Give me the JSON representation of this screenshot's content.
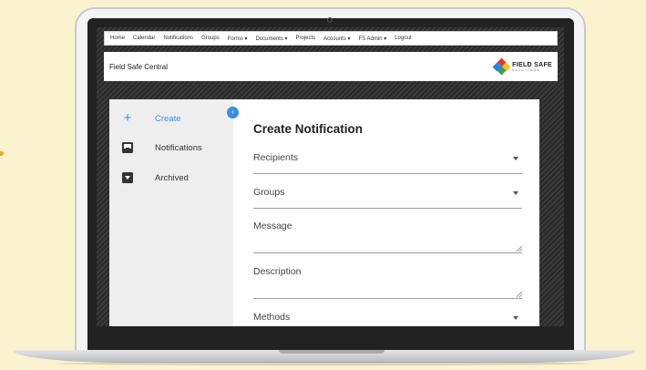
{
  "nav": {
    "items": [
      "Home",
      "Calendar",
      "Notifications",
      "Groups",
      "Forms ▾",
      "Documents ▾",
      "Projects",
      "Accounts ▾",
      "FS Admin ▾",
      "Logout"
    ]
  },
  "header": {
    "title": "Field Safe Central",
    "brand_name": "FIELD SAFE",
    "brand_sub": "SOLUTIONS"
  },
  "sidebar": {
    "items": [
      {
        "label": "Create",
        "icon": "plus-icon",
        "active": true
      },
      {
        "label": "Notifications",
        "icon": "inbox-icon",
        "active": false
      },
      {
        "label": "Archived",
        "icon": "archive-icon",
        "active": false
      }
    ],
    "collapse_icon": "chevron-left-icon"
  },
  "form": {
    "title": "Create Notification",
    "recipients_label": "Recipients",
    "groups_label": "Groups",
    "message_label": "Message",
    "description_label": "Description",
    "methods_label": "Methods"
  },
  "colors": {
    "accent": "#3b8fe0",
    "background": "#fbf3cf"
  }
}
